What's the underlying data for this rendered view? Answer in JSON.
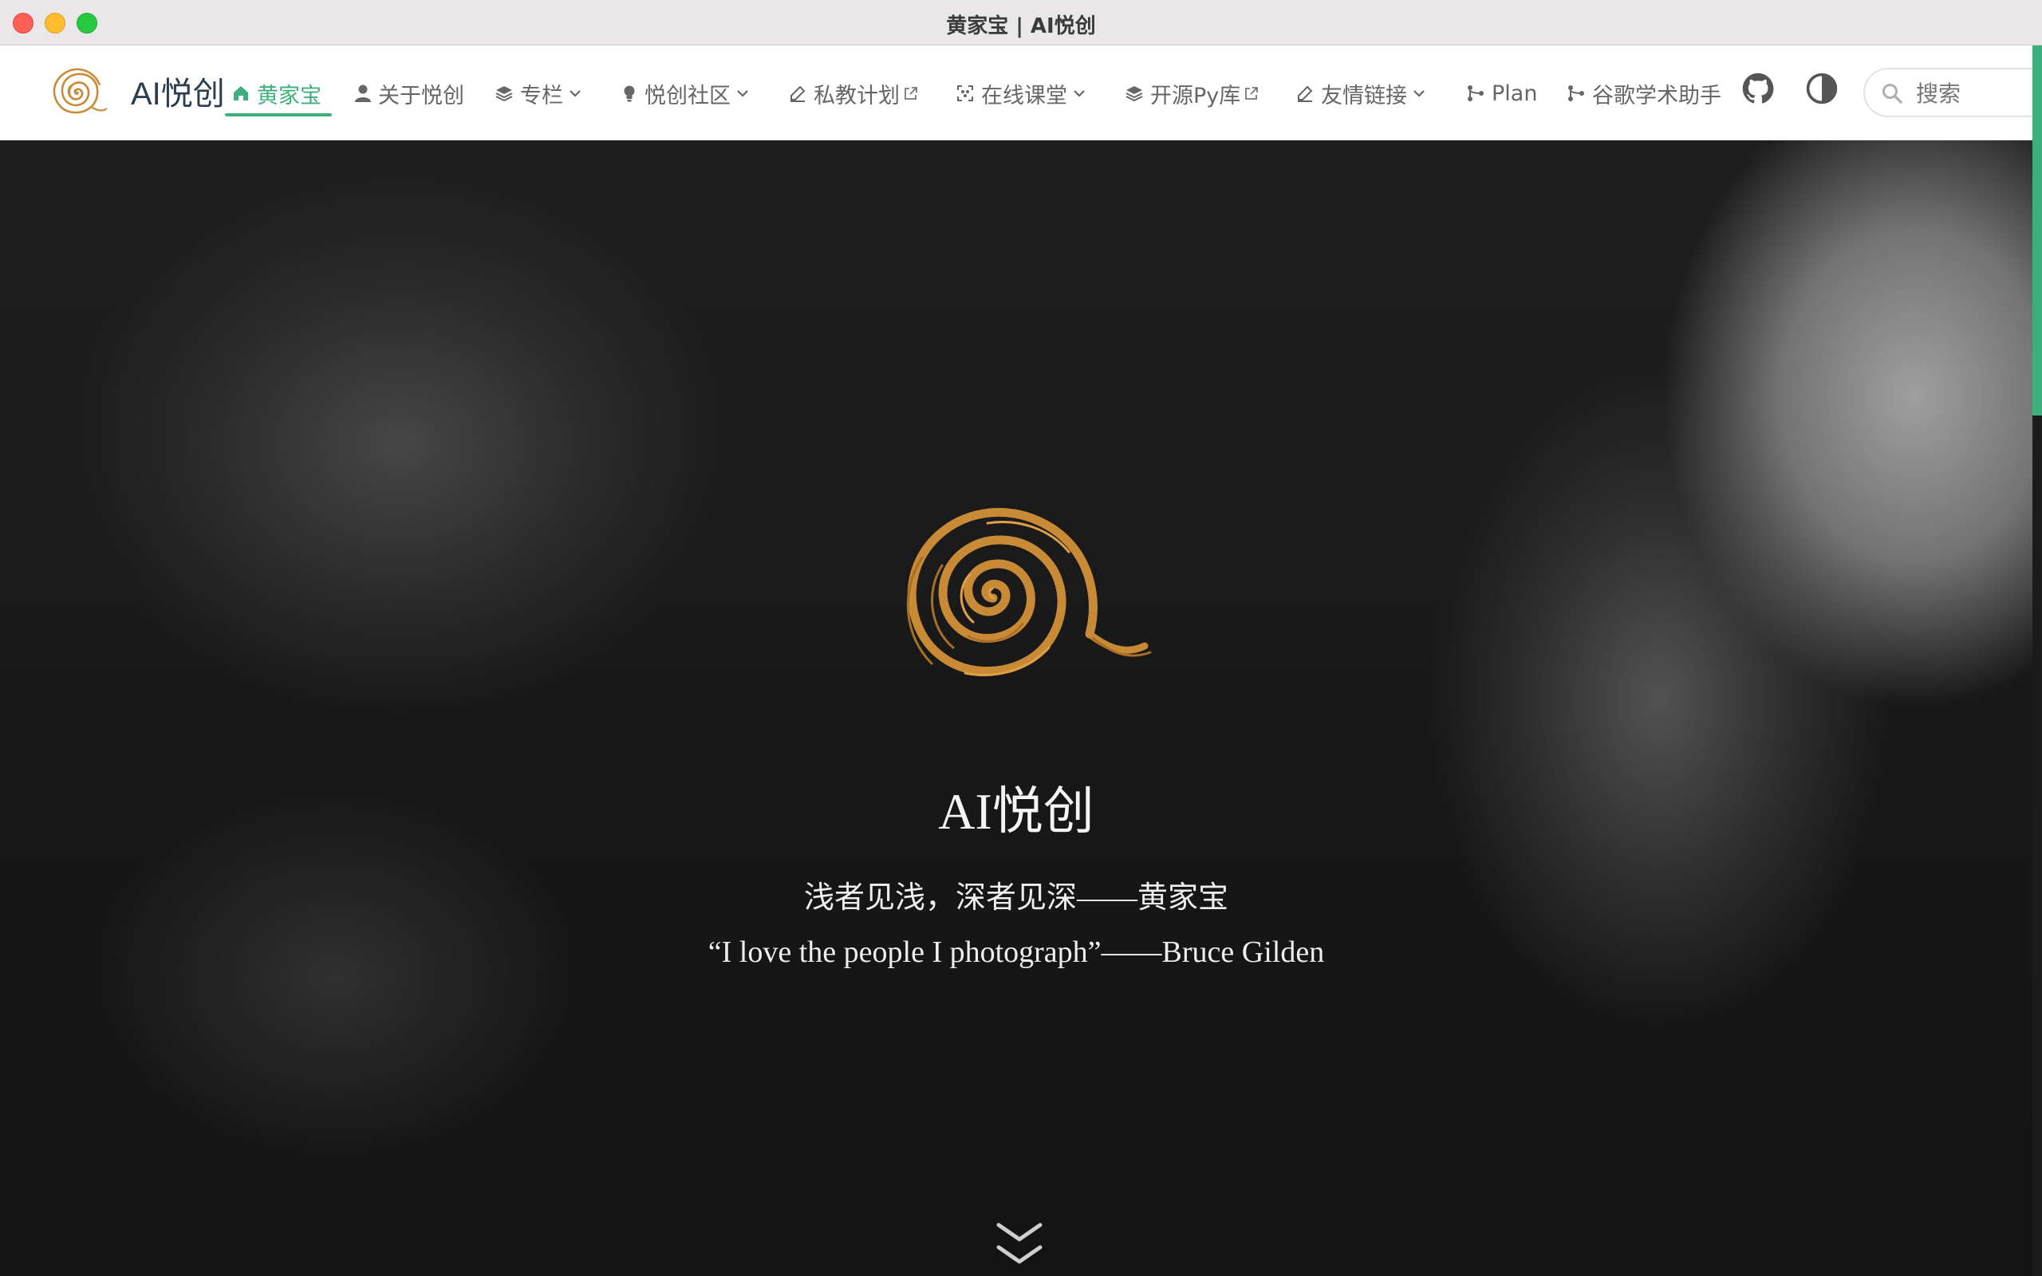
{
  "window": {
    "title": "黄家宝 | AI悦创"
  },
  "brand": {
    "name": "AI悦创"
  },
  "nav": {
    "items": [
      {
        "label": "黄家宝",
        "icon": "home-icon",
        "active": true
      },
      {
        "label": "关于悦创",
        "icon": "user-icon"
      },
      {
        "label": "专栏",
        "icon": "layers-icon",
        "dropdown": true
      },
      {
        "label": "悦创社区",
        "icon": "lightbulb-icon",
        "dropdown": true
      },
      {
        "label": "私教计划",
        "icon": "edit-icon",
        "external": true
      },
      {
        "label": "在线课堂",
        "icon": "focus-icon",
        "dropdown": true
      },
      {
        "label": "开源Py库",
        "icon": "layers-icon",
        "external": true
      },
      {
        "label": "友情链接",
        "icon": "edit-icon",
        "dropdown": true
      },
      {
        "label": "Plan",
        "icon": "branch-icon"
      },
      {
        "label": "谷歌学术助手",
        "icon": "branch-icon"
      }
    ]
  },
  "search": {
    "placeholder": "搜索"
  },
  "hero": {
    "title": "AI悦创",
    "tagline_cn": "浅者见浅，深者见深——黄家宝",
    "tagline_en": "“I love the people I photograph”——Bruce Gilden"
  },
  "colors": {
    "accent": "#3eaf7c",
    "logo": "#c98a35",
    "nav_text": "#666666"
  }
}
